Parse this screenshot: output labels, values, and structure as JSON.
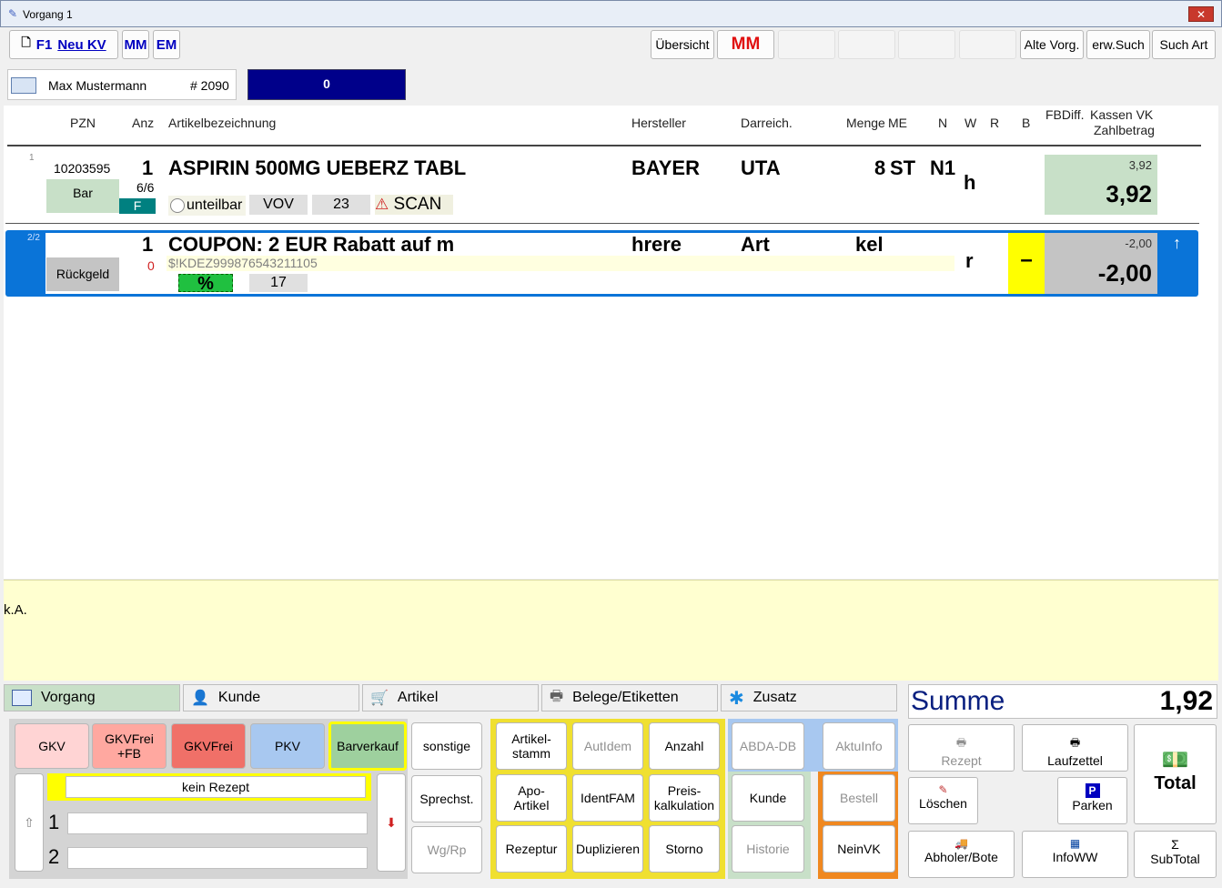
{
  "window": {
    "title": "Vorgang 1",
    "close": "✕"
  },
  "toolbar": {
    "f1": "F1",
    "neu_kv": "Neu KV",
    "mm": "MM",
    "em": "EM",
    "uebersicht": "Übersicht",
    "mm_red": "MM",
    "alte_vorg": "Alte Vorg.",
    "erw_such": "erw.Such",
    "such_art": "Such Art"
  },
  "customer": {
    "name": "Max Mustermann",
    "number": "# 2090",
    "count": "0"
  },
  "columns": {
    "pzn": "PZN",
    "anz": "Anz",
    "artikel": "Artikelbezeichnung",
    "hersteller": "Hersteller",
    "darreich": "Darreich.",
    "menge": "Menge",
    "me": "ME",
    "n": "N",
    "w": "W",
    "r": "R",
    "b": "B",
    "fbdiff": "FBDiff.",
    "kassen_vk": "Kassen VK",
    "zahlbetrag": "Zahlbetrag"
  },
  "rows": [
    {
      "index": "1",
      "pzn": "10203595",
      "anz": "1",
      "name": "ASPIRIN 500MG UEBERZ TABL",
      "hersteller": "BAYER",
      "darreich": "UTA",
      "menge": "8",
      "me": "ST",
      "n": "N1",
      "w": "h",
      "pay": "Bar",
      "fraction": "6/6",
      "flag": "F",
      "unteilbar": "unteilbar",
      "vov": "VOV",
      "num": "23",
      "scan": "SCAN",
      "price_small": "3,92",
      "price": "3,92"
    },
    {
      "index": "2/2",
      "anz": "1",
      "name": "COUPON: 2 EUR Rabatt auf m",
      "hersteller": "hrere",
      "darreich": "Art",
      "menge": "kel",
      "w": "r",
      "pay": "Rückgeld",
      "zero": "0",
      "code": "$!KDEZ999876543211105",
      "pct": "%",
      "num": "17",
      "minus": "–",
      "price_small": "-2,00",
      "price": "-2,00"
    }
  ],
  "info": {
    "text": "k.A."
  },
  "tabs": [
    "Vorgang",
    "Kunde",
    "Artikel",
    "Belege/Etiketten",
    "Zusatz"
  ],
  "kv_buttons": [
    "GKV",
    "GKVFrei\n+FB",
    "GKVFrei",
    "PKV",
    "Barverkauf"
  ],
  "rezept": {
    "kein": "kein Rezept",
    "line1": "1",
    "line2": "2"
  },
  "side_buttons": [
    "sonstige",
    "Sprechst.",
    "Wg/Rp"
  ],
  "artikel_buttons": [
    "Artikel-\nstamm",
    "AutIdem",
    "Anzahl",
    "Apo-\nArtikel",
    "IdentFAM",
    "Preis-\nkalkulation",
    "Rezeptur",
    "Duplizieren",
    "Storno"
  ],
  "abda_buttons": [
    "ABDA-DB",
    "AktuInfo",
    "Kunde",
    "Bestell",
    "Historie",
    "NeinVK"
  ],
  "summe": {
    "label": "Summe",
    "value": "1,92"
  },
  "right_buttons": {
    "rezept": "Rezept",
    "laufzettel": "Laufzettel",
    "total": "Total",
    "loeschen": "Löschen",
    "parken": "Parken",
    "abholer": "Abholer/Bote",
    "infoww": "InfoWW",
    "subtotal": "SubTotal"
  }
}
